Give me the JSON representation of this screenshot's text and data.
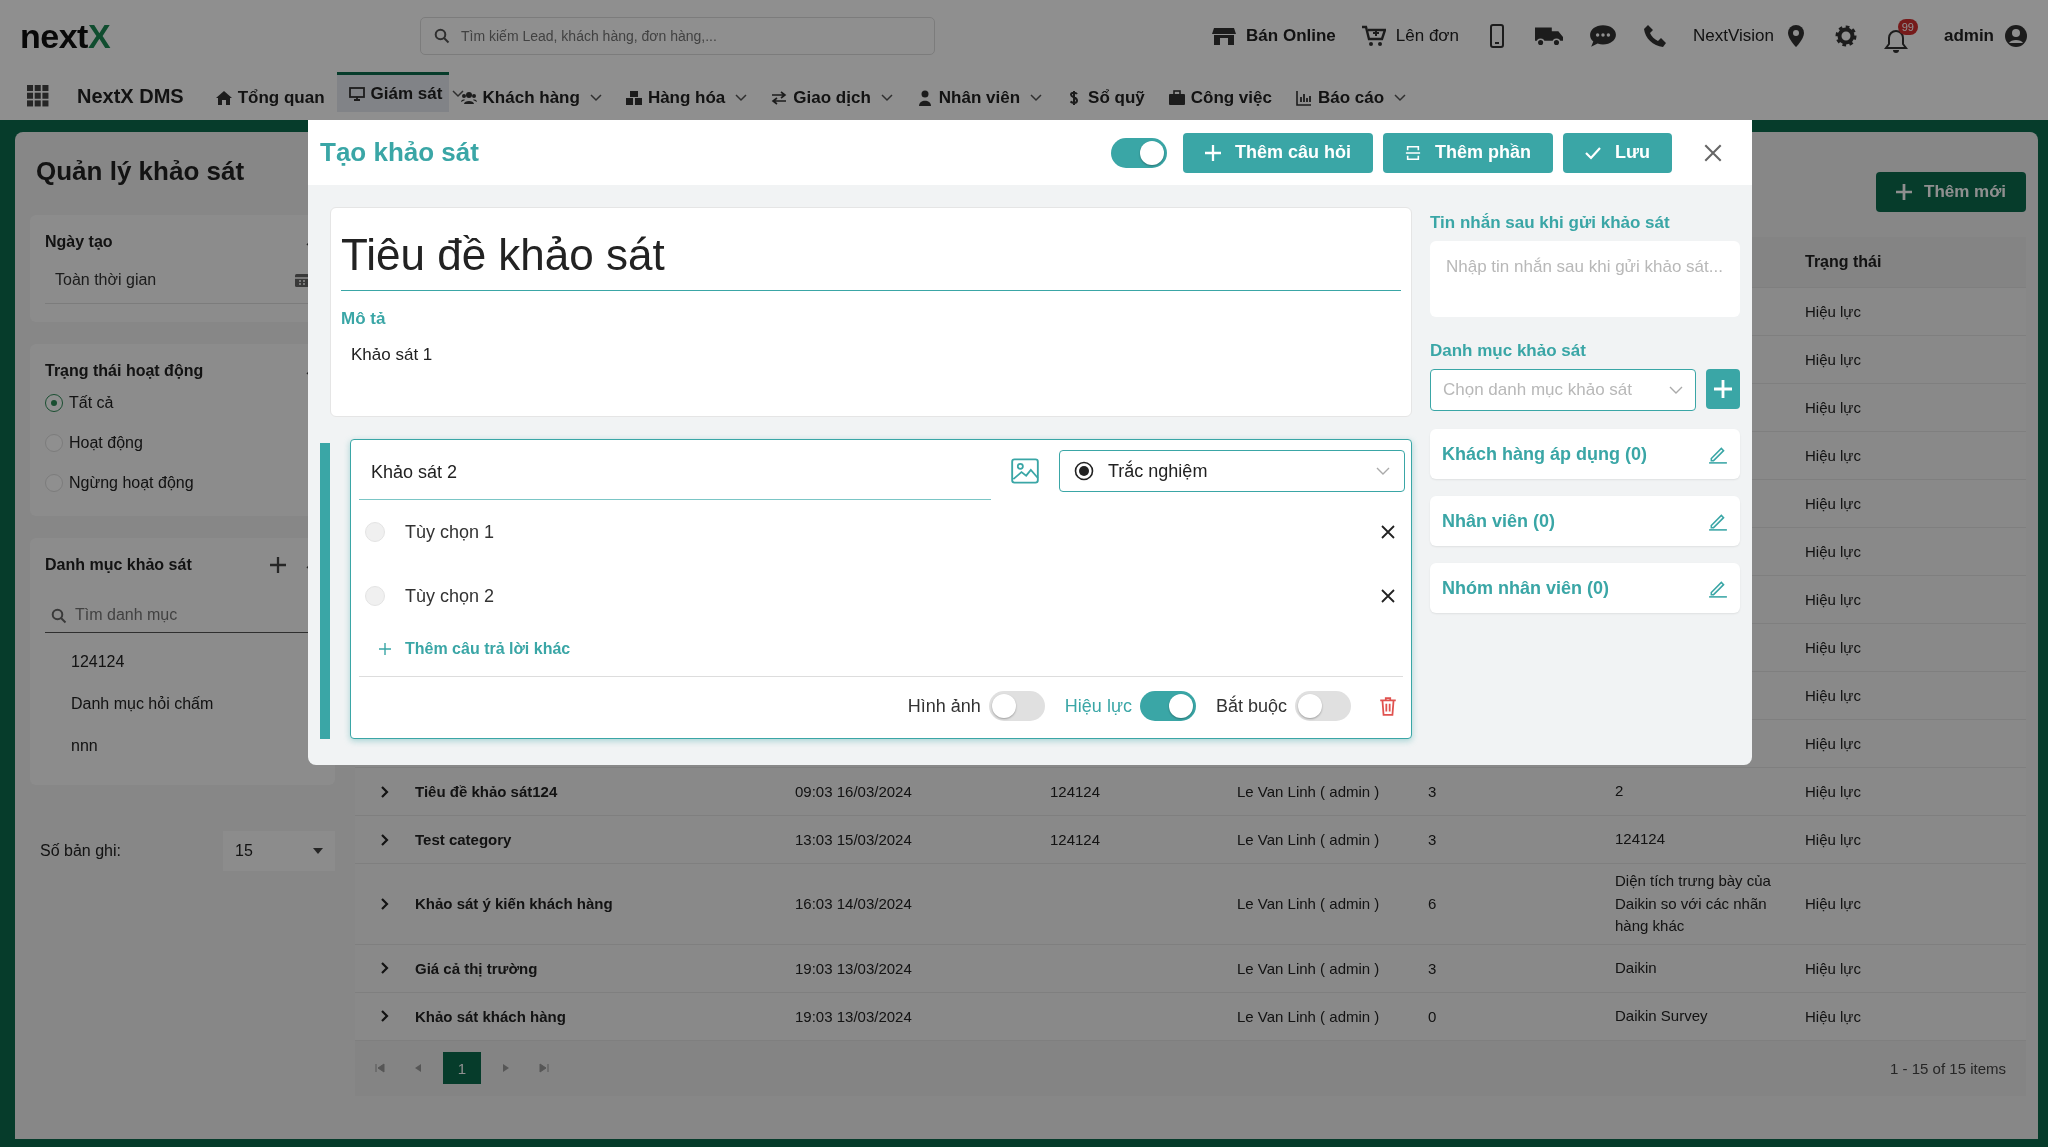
{
  "topbar": {
    "logo_text": "next",
    "logo_accent": "X",
    "search_placeholder": "Tìm kiếm Lead, khách hàng, đơn hàng,...",
    "actions": [
      {
        "kind": "store",
        "label": "Bán Online",
        "bold": true
      },
      {
        "kind": "cart",
        "label": "Lên đơn",
        "bold": false
      },
      {
        "kind": "mobile"
      },
      {
        "kind": "truck"
      },
      {
        "kind": "chat"
      },
      {
        "kind": "phone"
      },
      {
        "kind": "location",
        "label": "NextVision",
        "bold": false
      },
      {
        "kind": "settings"
      },
      {
        "kind": "bell",
        "badge": "99"
      },
      {
        "kind": "user",
        "label": "admin",
        "bold": true
      }
    ]
  },
  "nav": {
    "app_name": "NextX DMS",
    "items": [
      {
        "kind": "home",
        "label": "Tổng quan",
        "dropdown": false,
        "selected": false
      },
      {
        "kind": "monitor",
        "label": "Giám sát",
        "dropdown": true,
        "selected": true
      },
      {
        "kind": "users",
        "label": "Khách hàng",
        "dropdown": true,
        "selected": false
      },
      {
        "kind": "boxes",
        "label": "Hàng hóa",
        "dropdown": true,
        "selected": false
      },
      {
        "kind": "swap",
        "label": "Giao dịch",
        "dropdown": true,
        "selected": false
      },
      {
        "kind": "person",
        "label": "Nhân viên",
        "dropdown": true,
        "selected": false
      },
      {
        "kind": "dollar",
        "label": "Sổ quỹ",
        "dropdown": false,
        "selected": false
      },
      {
        "kind": "briefcase",
        "label": "Công việc",
        "dropdown": false,
        "selected": false
      },
      {
        "kind": "chart",
        "label": "Báo cáo",
        "dropdown": true,
        "selected": false
      }
    ]
  },
  "sidebar": {
    "title": "Quản lý khảo sát",
    "date_filter": {
      "title": "Ngày tạo",
      "expanded": true,
      "value": "Toàn thời gian"
    },
    "status_filter": {
      "title": "Trạng thái hoạt động",
      "expanded": true,
      "options": [
        {
          "label": "Tất cả",
          "selected": true
        },
        {
          "label": "Hoạt động",
          "selected": false
        },
        {
          "label": "Ngừng hoạt động",
          "selected": false
        }
      ]
    },
    "category_filter": {
      "title": "Danh mục khảo sát",
      "expanded": true,
      "search_placeholder": "Tìm danh mục",
      "items": [
        "124124",
        "Danh mục hỏi chấm",
        "nnn"
      ]
    },
    "page_size": {
      "label": "Số bản ghi:",
      "value": "15"
    }
  },
  "main": {
    "add_button": "Thêm mới",
    "table": {
      "status_header": "Trạng thái",
      "rows": [
        {
          "status": "Hiệu lực"
        },
        {
          "status": "Hiệu lực"
        },
        {
          "status": "Hiệu lực"
        },
        {
          "status": "Hiệu lực"
        },
        {
          "status": "Hiệu lực"
        },
        {
          "status": "Hiệu lực"
        },
        {
          "status": "Hiệu lực"
        },
        {
          "status": "Hiệu lực"
        },
        {
          "status": "Hiệu lực"
        },
        {
          "status": "Hiệu lực"
        },
        {
          "name": "Tiêu đề khảo sát124",
          "date": "09:03 16/03/2024",
          "column_3": "124124",
          "creator": "Le Van Linh ( admin )",
          "column_5": "3",
          "column_6": "2",
          "status": "Hiệu lực"
        },
        {
          "name": "Test category",
          "date": "13:03 15/03/2024",
          "column_3": "124124",
          "creator": "Le Van Linh ( admin )",
          "column_5": "3",
          "column_6": "124124",
          "status": "Hiệu lực"
        },
        {
          "name": "Khảo sát ý kiến khách hàng",
          "date": "16:03 14/03/2024",
          "creator": "Le Van Linh ( admin )",
          "column_5": "6",
          "column_6": "Diện tích trưng bày của Daikin so với các nhãn hàng khác",
          "status": "Hiệu lực"
        },
        {
          "name": "Giá cả thị trường",
          "date": "19:03 13/03/2024",
          "creator": "Le Van Linh ( admin )",
          "column_5": "3",
          "column_6": "Daikin",
          "status": "Hiệu lực"
        },
        {
          "name": "Khảo sát khách hàng",
          "date": "19:03 13/03/2024",
          "creator": "Le Van Linh ( admin )",
          "column_5": "0",
          "column_6": "Daikin Survey",
          "status": "Hiệu lực"
        }
      ]
    },
    "pagination": {
      "pages": [
        {
          "label": "1",
          "selected": true
        }
      ],
      "summary": "1 - 15 of 15 items"
    }
  },
  "modal": {
    "title": "Tạo khảo sát",
    "active": {
      "on": true
    },
    "buttons": [
      {
        "kind": "add",
        "label": "Thêm câu hỏi"
      },
      {
        "kind": "section",
        "label": "Thêm phần"
      },
      {
        "kind": "save",
        "label": "Lưu"
      }
    ],
    "survey_title": "Tiêu đề khảo sát",
    "description_label": "Mô tả",
    "description": "Khảo sát 1",
    "question": {
      "title": "Khảo sát 2",
      "type": "Trắc nghiệm",
      "options": [
        {
          "label": "Tùy chọn 1",
          "selected": false
        },
        {
          "label": "Tùy chọn 2",
          "selected": false
        }
      ],
      "add_option": "Thêm câu trả lời khác",
      "toggles": [
        {
          "label": "Hình ảnh",
          "on": false
        },
        {
          "label": "Hiệu lực",
          "on": true
        },
        {
          "label": "Bắt buộc",
          "on": false
        }
      ]
    },
    "message_label": "Tin nhắn sau khi gửi khảo sát",
    "message_placeholder": "Nhập tin nhắn sau khi gửi khảo sát...",
    "category_label": "Danh mục khảo sát",
    "category_placeholder": "Chọn danh mục khảo sát",
    "assignments": [
      {
        "label": "Khách hàng áp dụng (0)"
      },
      {
        "label": "Nhân viên (0)"
      },
      {
        "label": "Nhóm nhân viên (0)"
      }
    ]
  }
}
